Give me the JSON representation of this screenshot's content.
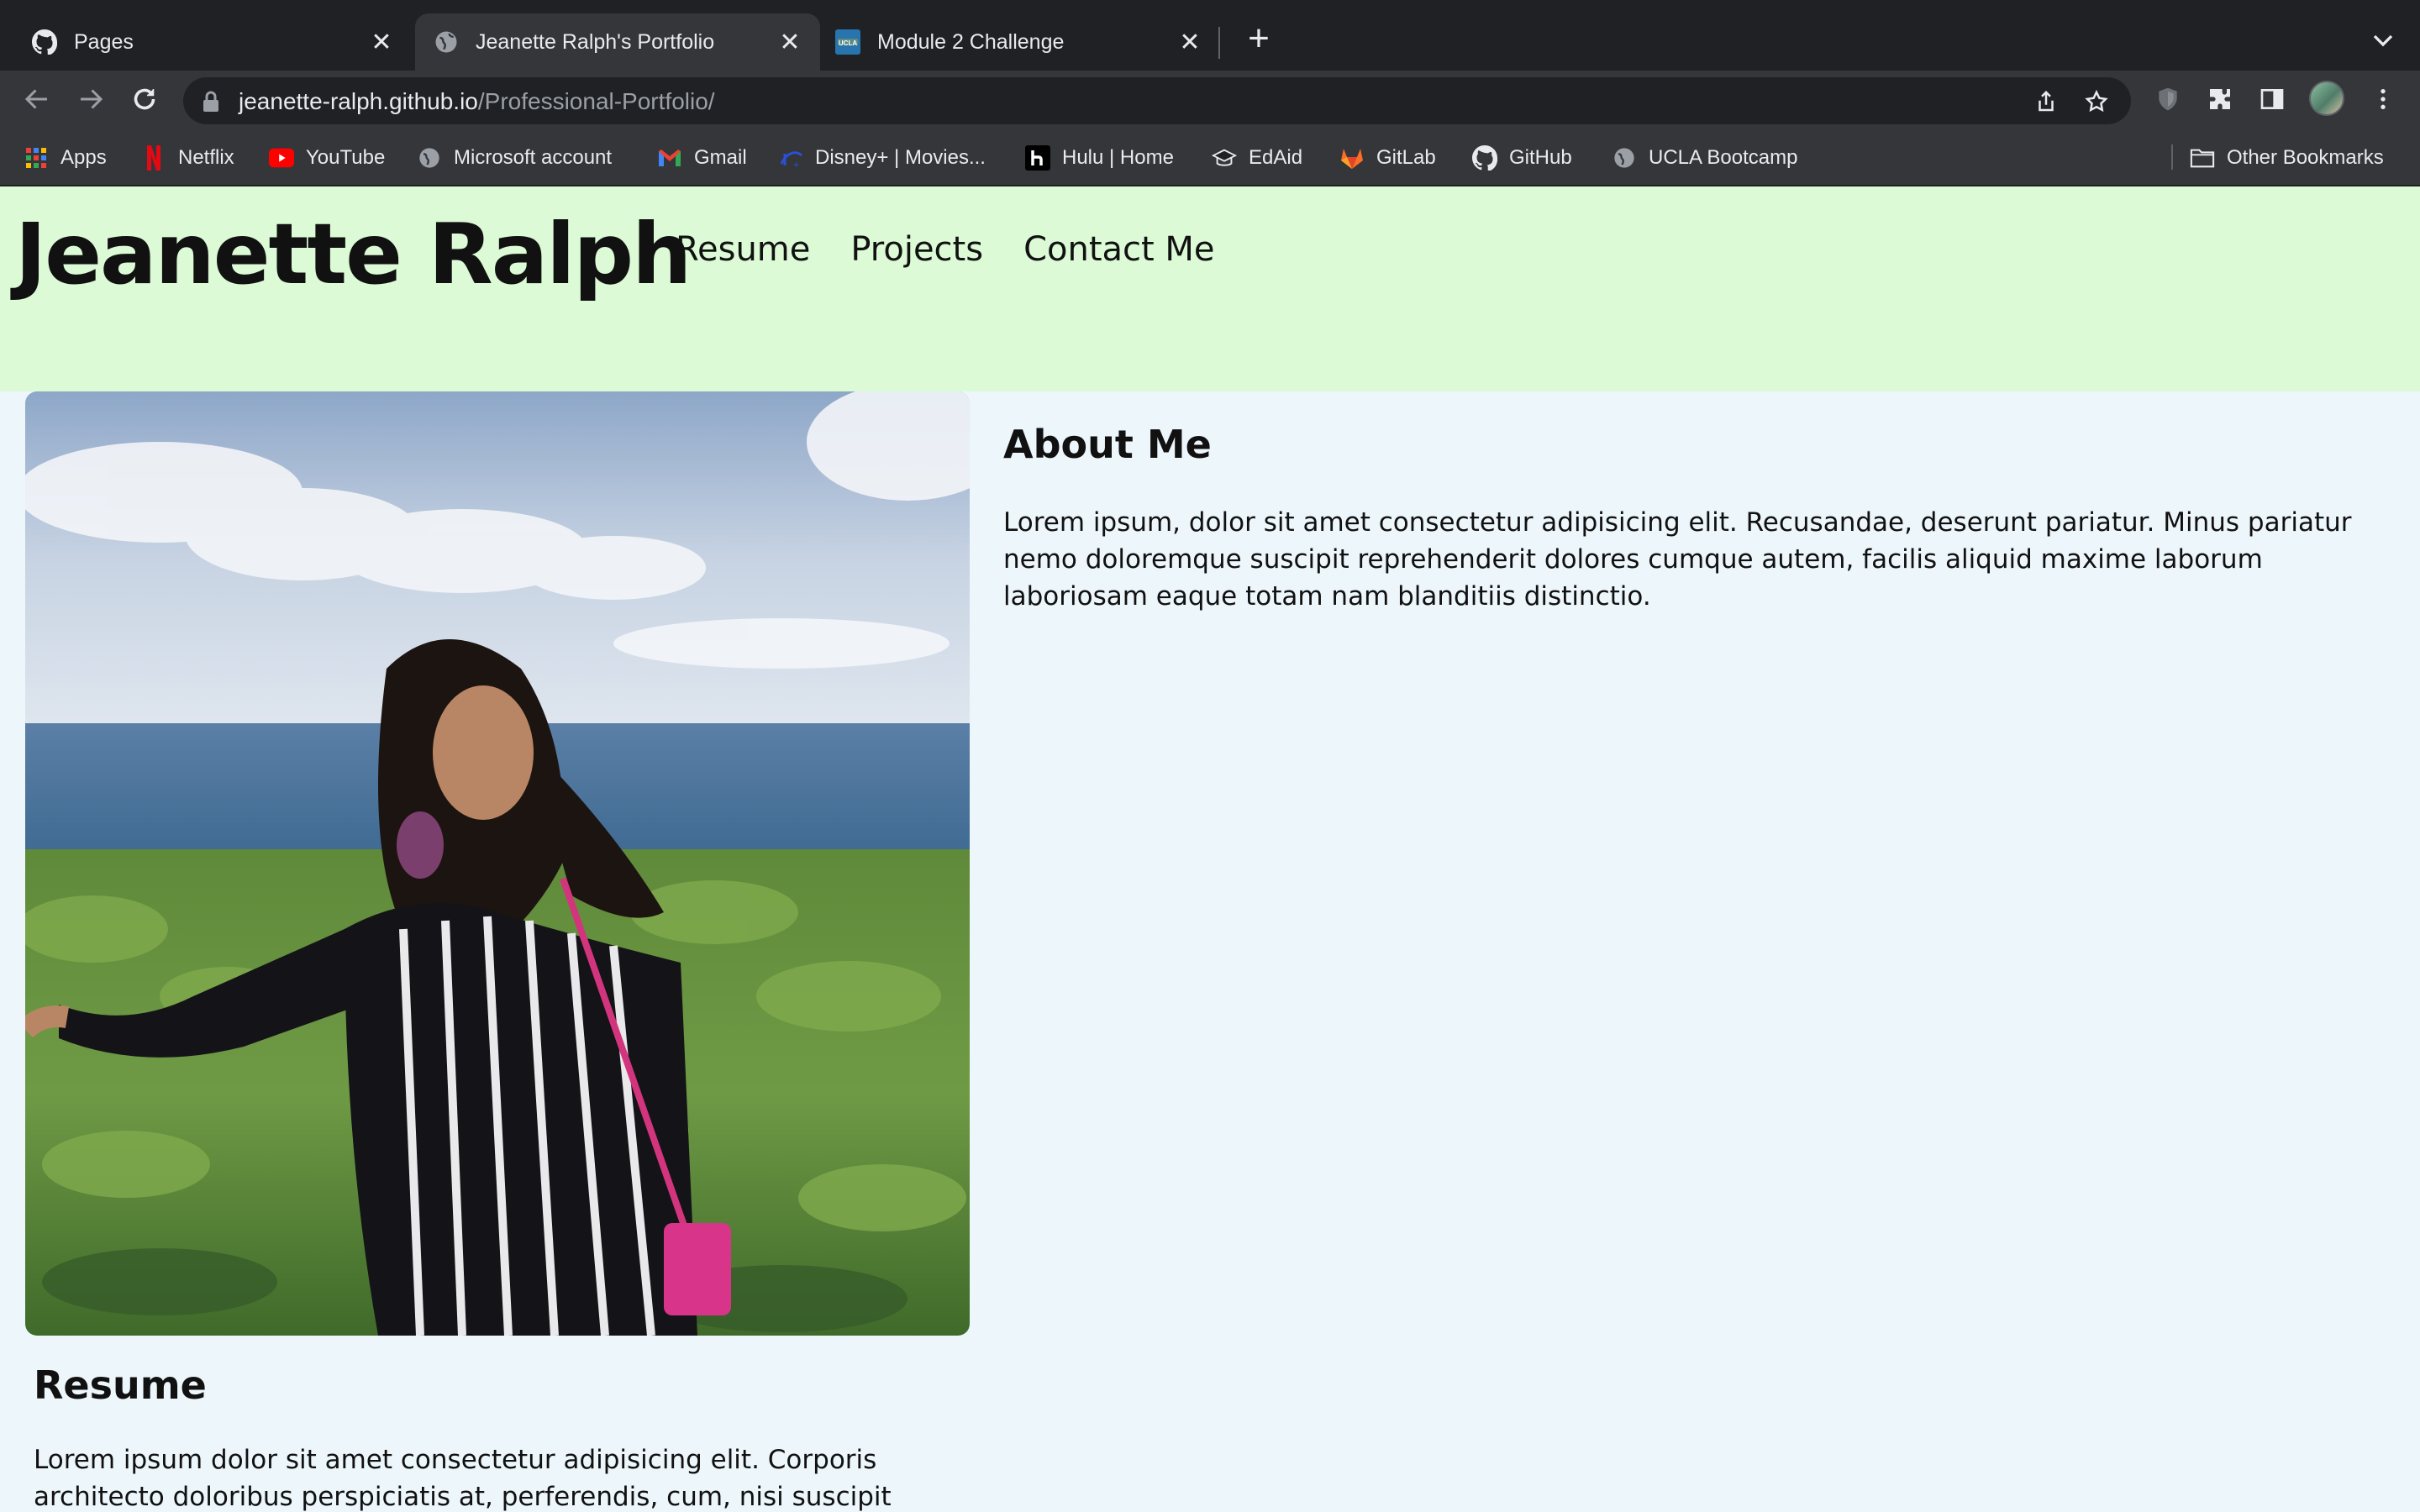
{
  "browser": {
    "tabs": [
      {
        "title": "Pages",
        "icon": "github-icon",
        "active": false
      },
      {
        "title": "Jeanette Ralph's Portfolio",
        "icon": "globe-icon",
        "active": true
      },
      {
        "title": "Module 2 Challenge",
        "icon": "ucla-icon",
        "active": false
      }
    ],
    "tab_close_glyph": "✕",
    "new_tab_glyph": "+",
    "url_host": "jeanette-ralph.github.io",
    "url_path": "/Professional-Portfolio/",
    "bookmarks": [
      {
        "label": "Apps",
        "icon": "apps-grid-icon"
      },
      {
        "label": "Netflix",
        "icon": "netflix-icon"
      },
      {
        "label": "YouTube",
        "icon": "youtube-icon"
      },
      {
        "label": "Microsoft account",
        "icon": "globe-icon"
      },
      {
        "label": "Gmail",
        "icon": "gmail-icon"
      },
      {
        "label": "Disney+ | Movies...",
        "icon": "disney-icon"
      },
      {
        "label": "Hulu | Home",
        "icon": "hulu-icon"
      },
      {
        "label": "EdAid",
        "icon": "graduation-cap-icon"
      },
      {
        "label": "GitLab",
        "icon": "gitlab-icon"
      },
      {
        "label": "GitHub",
        "icon": "github-icon"
      },
      {
        "label": "UCLA Bootcamp",
        "icon": "globe-icon"
      }
    ],
    "other_bookmarks": "Other Bookmarks",
    "colors": {
      "tabstrip": "#202124",
      "toolbar": "#35363a",
      "text": "#e8eaed"
    }
  },
  "site": {
    "title": "Jeanette Ralph",
    "nav": [
      "Resume",
      "Projects",
      "Contact Me"
    ],
    "about": {
      "heading": "About Me",
      "body": "Lorem ipsum, dolor sit amet consectetur adipisicing elit. Recusandae, deserunt pariatur. Minus pariatur nemo doloremque suscipit reprehenderit dolores cumque autem, facilis aliquid maxime laborum laboriosam eaque totam nam blanditiis distinctio."
    },
    "resume": {
      "heading": "Resume",
      "body": "Lorem ipsum dolor sit amet consectetur adipisicing elit. Corporis architecto doloribus perspiciatis at, perferendis, cum, nisi suscipit"
    },
    "colors": {
      "header_bg": "#dbfad5",
      "page_bg": "#edf6fb"
    }
  }
}
